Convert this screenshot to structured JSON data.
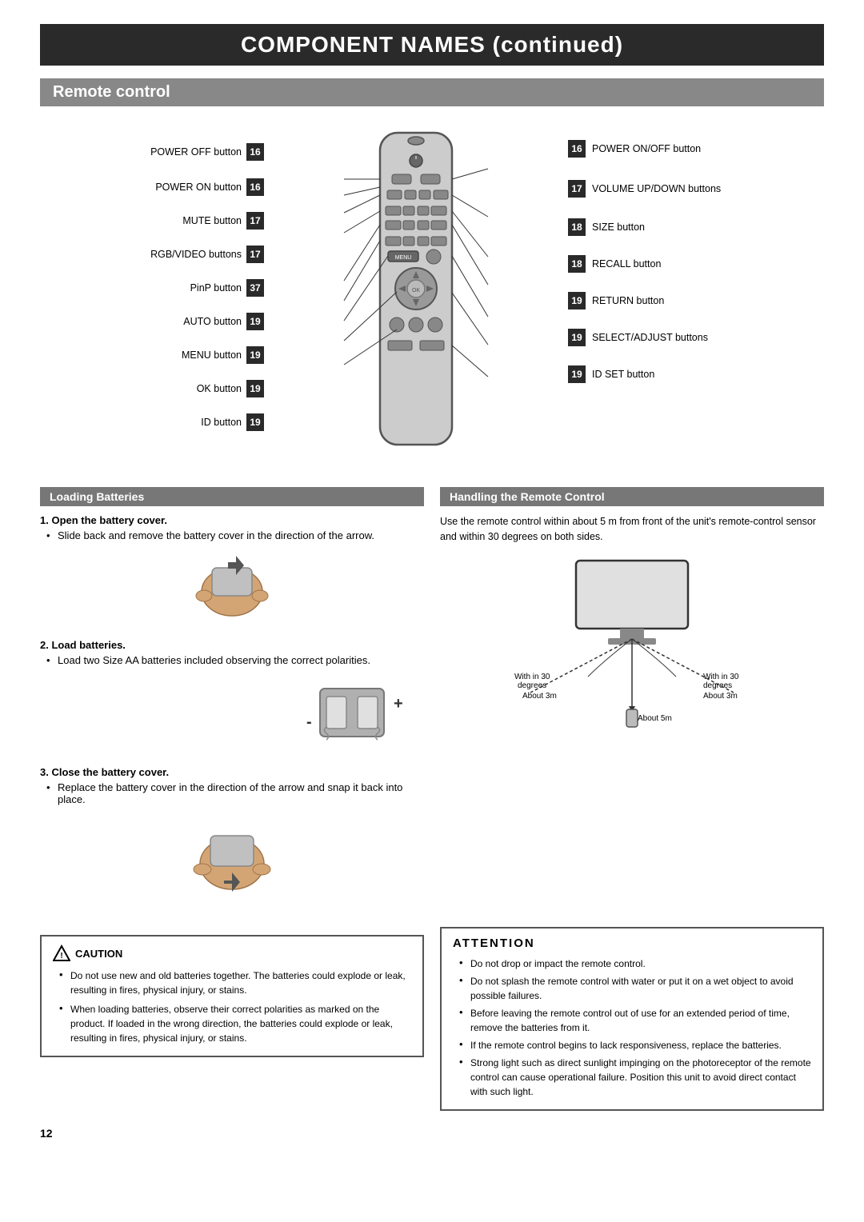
{
  "page": {
    "main_title": "COMPONENT NAMES (continued)",
    "section_title": "Remote control",
    "page_number": "12"
  },
  "remote": {
    "left_labels": [
      {
        "text": "POWER OFF button",
        "badge": "16"
      },
      {
        "text": "POWER ON button",
        "badge": "16"
      },
      {
        "text": "MUTE button",
        "badge": "17"
      },
      {
        "text": "RGB/VIDEO buttons",
        "badge": "17"
      },
      {
        "text": "PinP button",
        "badge": "37"
      },
      {
        "text": "AUTO button",
        "badge": "19"
      },
      {
        "text": "MENU button",
        "badge": "19"
      },
      {
        "text": "OK button",
        "badge": "19"
      },
      {
        "text": "ID button",
        "badge": "19"
      }
    ],
    "right_labels": [
      {
        "badge": "16",
        "text": "POWER ON/OFF button"
      },
      {
        "badge": "17",
        "text": "VOLUME UP/DOWN buttons"
      },
      {
        "badge": "18",
        "text": "SIZE button"
      },
      {
        "badge": "18",
        "text": "RECALL button"
      },
      {
        "badge": "19",
        "text": "RETURN button"
      },
      {
        "badge": "19",
        "text": "SELECT/ADJUST buttons"
      },
      {
        "badge": "19",
        "text": "ID SET button"
      }
    ]
  },
  "loading_batteries": {
    "title": "Loading Batteries",
    "step1_title": "1. Open the battery cover.",
    "step1_bullet": "Slide back and remove the battery cover in the direction of the arrow.",
    "step2_title": "2. Load batteries.",
    "step2_bullet": "Load two Size AA batteries included observing the correct polarities.",
    "step3_title": "3. Close the battery cover.",
    "step3_bullet": "Replace the battery cover in the direction of the arrow and snap it back into place."
  },
  "handling_remote": {
    "title": "Handling the Remote Control",
    "description": "Use the remote control within about 5 m from front of the unit's remote-control sensor and within 30 degrees on both sides.",
    "labels": {
      "within_30_left": "With in 30 degrees",
      "within_30_right": "With in 30 degrees",
      "about_3m_left": "About 3m",
      "about_3m_right": "About 3m",
      "about_5m": "About 5m"
    }
  },
  "caution": {
    "title": "CAUTION",
    "bullets": [
      "Do not use new and old batteries together.  The batteries could explode or leak, resulting in fires, physical injury, or stains.",
      "When loading batteries, observe their correct polarities as marked on the product. If loaded in the wrong direction, the batteries could explode or leak, resulting in fires, physical injury, or stains."
    ]
  },
  "attention": {
    "title": "ATTENTION",
    "bullets": [
      "Do not drop or impact the remote control.",
      "Do not splash the remote control with water or put it on a wet object to avoid possible failures.",
      "Before leaving the remote control out of use for an extended period of time, remove the batteries from it.",
      "If the remote control begins to lack responsiveness, replace the batteries.",
      "Strong light such as direct sunlight impinging on the photoreceptor of the remote control can cause operational failure. Position this unit to avoid direct contact with such light."
    ]
  }
}
